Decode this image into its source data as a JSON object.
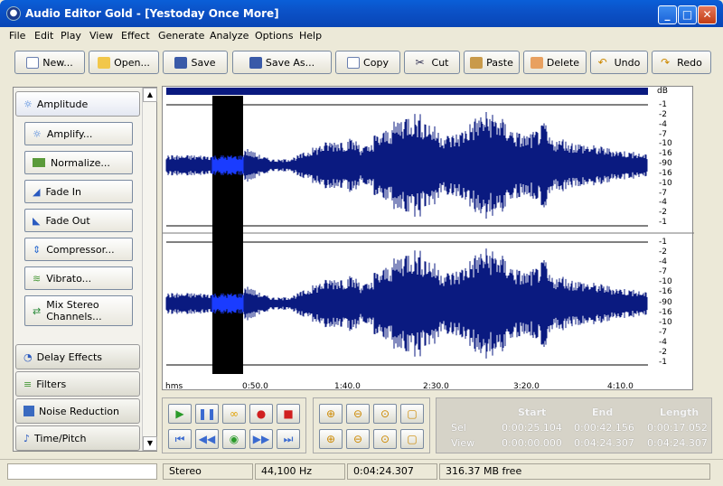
{
  "window": {
    "title": "Audio Editor Gold - [Yestoday Once More]"
  },
  "menu": [
    "File",
    "Edit",
    "Play",
    "View",
    "Effect",
    "Generate",
    "Analyze",
    "Options",
    "Help"
  ],
  "toolbar": {
    "new": "New...",
    "open": "Open...",
    "save": "Save",
    "save_as": "Save As...",
    "copy": "Copy",
    "cut": "Cut",
    "paste": "Paste",
    "delete": "Delete",
    "undo": "Undo",
    "redo": "Redo"
  },
  "left_panel": {
    "amplitude_group": "Amplitude",
    "actions": [
      "Amplify...",
      "Normalize...",
      "Fade In",
      "Fade Out",
      "Compressor...",
      "Vibrato...",
      "Mix Stereo Channels..."
    ],
    "groups": [
      "Delay Effects",
      "Filters",
      "Noise Reduction",
      "Time/Pitch"
    ]
  },
  "db_scale": {
    "unit": "dB",
    "ticks": [
      "-1",
      "-2",
      "-4",
      "-7",
      "-10",
      "-16",
      "-90",
      "-16",
      "-10",
      "-7",
      "-4",
      "-2",
      "-1"
    ]
  },
  "timeline": {
    "labels": [
      "hms",
      "0:50.0",
      "1:40.0",
      "2:30.0",
      "3:20.0",
      "4:10.0"
    ]
  },
  "info": {
    "headers": [
      "Start",
      "End",
      "Length"
    ],
    "sel_label": "Sel",
    "view_label": "View",
    "sel": [
      "0:00:25.104",
      "0:00:42.156",
      "0:00:17.052"
    ],
    "view": [
      "0:00:00.000",
      "0:04:24.307",
      "0:04:24.307"
    ]
  },
  "status": {
    "channels": "Stereo",
    "rate": "44,100 Hz",
    "duration": "0:04:24.307",
    "free": "316.37 MB free"
  },
  "colors": {
    "waveform": "#0a1a80",
    "selection": "#000000",
    "selection_wave": "#1a3cff"
  }
}
